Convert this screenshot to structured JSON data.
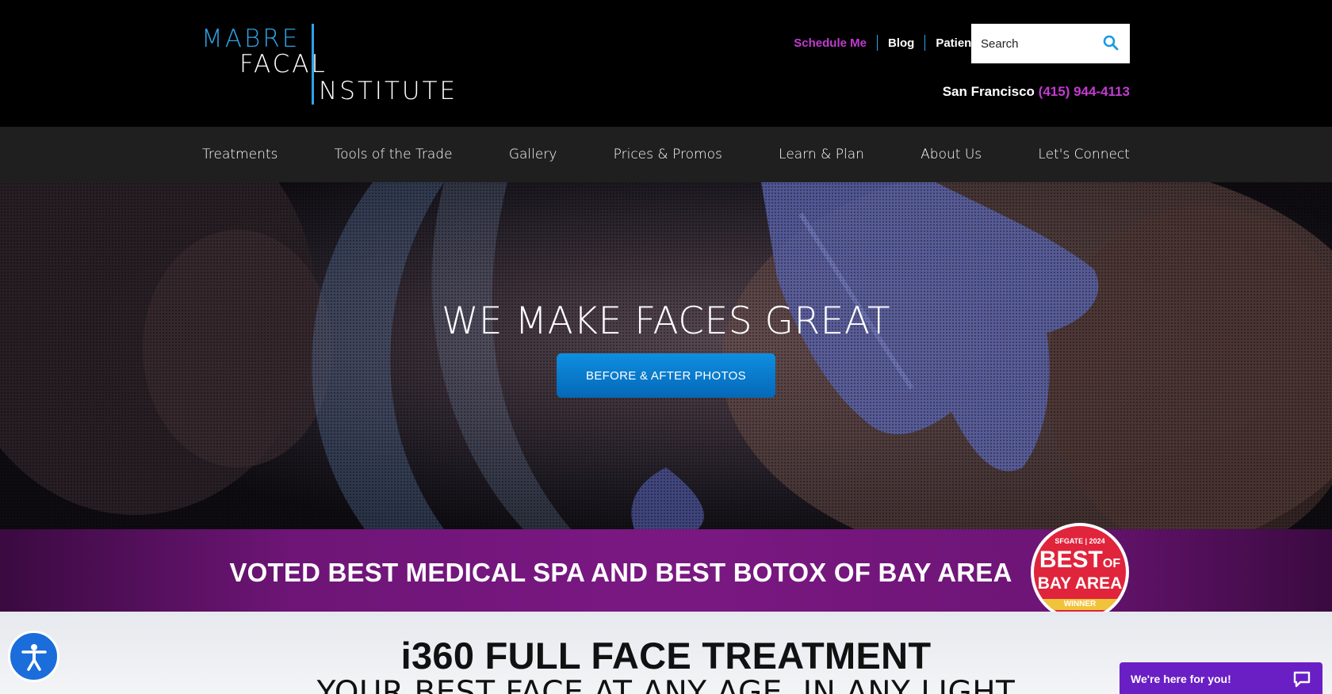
{
  "header": {
    "logo": {
      "line1": "MABRE",
      "line2": "FACAL",
      "line3": "NSTITUTE"
    },
    "util_nav": {
      "schedule": "Schedule Me",
      "blog": "Blog",
      "portal": "Patient Portal"
    },
    "search": {
      "placeholder": "Search"
    },
    "location": {
      "city": "San Francisco",
      "phone": "(415) 944-4113"
    }
  },
  "main_nav": {
    "items": [
      {
        "label": "Treatments"
      },
      {
        "label": "Tools of the Trade"
      },
      {
        "label": "Gallery"
      },
      {
        "label": "Prices & Promos"
      },
      {
        "label": "Learn & Plan"
      },
      {
        "label": "About Us"
      },
      {
        "label": "Let's Connect"
      }
    ]
  },
  "hero": {
    "title": "WE MAKE FACES GREAT",
    "button": "BEFORE & AFTER PHOTOS"
  },
  "award_banner": {
    "text": "VOTED BEST MEDICAL SPA AND BEST BOTOX OF BAY AREA",
    "badge": {
      "source": "SFGATE | 2024",
      "best": "BEST",
      "of": "OF",
      "area": "BAY AREA",
      "winner": "WINNER"
    }
  },
  "section": {
    "title": "i360 FULL FACE TREATMENT",
    "subtitle": "YOUR BEST FACE AT ANY AGE, IN ANY LIGHT"
  },
  "chat": {
    "label": "We're here for you!"
  },
  "colors": {
    "accent_blue": "#2ea3e6",
    "accent_magenta": "#c23bd0",
    "banner_purple": "#7a1882",
    "button_blue": "#0a7ad0"
  }
}
